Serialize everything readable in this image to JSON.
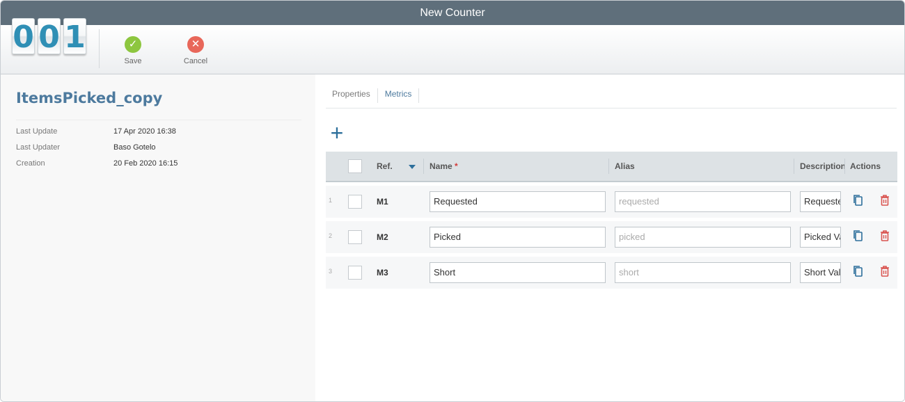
{
  "window": {
    "title": "New Counter"
  },
  "logo": {
    "digits": [
      "0",
      "0",
      "1"
    ]
  },
  "toolbar": {
    "save_label": "Save",
    "cancel_label": "Cancel"
  },
  "record": {
    "title": "ItemsPicked_copy",
    "meta": [
      {
        "label": "Last Update",
        "value": "17 Apr 2020 16:38"
      },
      {
        "label": "Last Updater",
        "value": "Baso Gotelo"
      },
      {
        "label": "Creation",
        "value": "20 Feb 2020 16:15"
      }
    ]
  },
  "tabs": [
    {
      "label": "Properties",
      "active": false
    },
    {
      "label": "Metrics",
      "active": true
    }
  ],
  "grid": {
    "headers": {
      "ref": "Ref.",
      "name": "Name",
      "required_mark": "*",
      "alias": "Alias",
      "description": "Description",
      "actions": "Actions"
    },
    "rows": [
      {
        "num": "1",
        "ref": "M1",
        "name": "Requested",
        "alias": "requested",
        "description": "Requested Value"
      },
      {
        "num": "2",
        "ref": "M2",
        "name": "Picked",
        "alias": "picked",
        "description": "Picked Value"
      },
      {
        "num": "3",
        "ref": "M3",
        "name": "Short",
        "alias": "short",
        "description": "Short Value"
      }
    ]
  },
  "colors": {
    "titlebar": "#5f6f7b",
    "accent": "#4d7a9e",
    "save": "#8dc63f",
    "cancel": "#e8675a",
    "delete": "#d9534f",
    "copy": "#2d6f9b"
  }
}
